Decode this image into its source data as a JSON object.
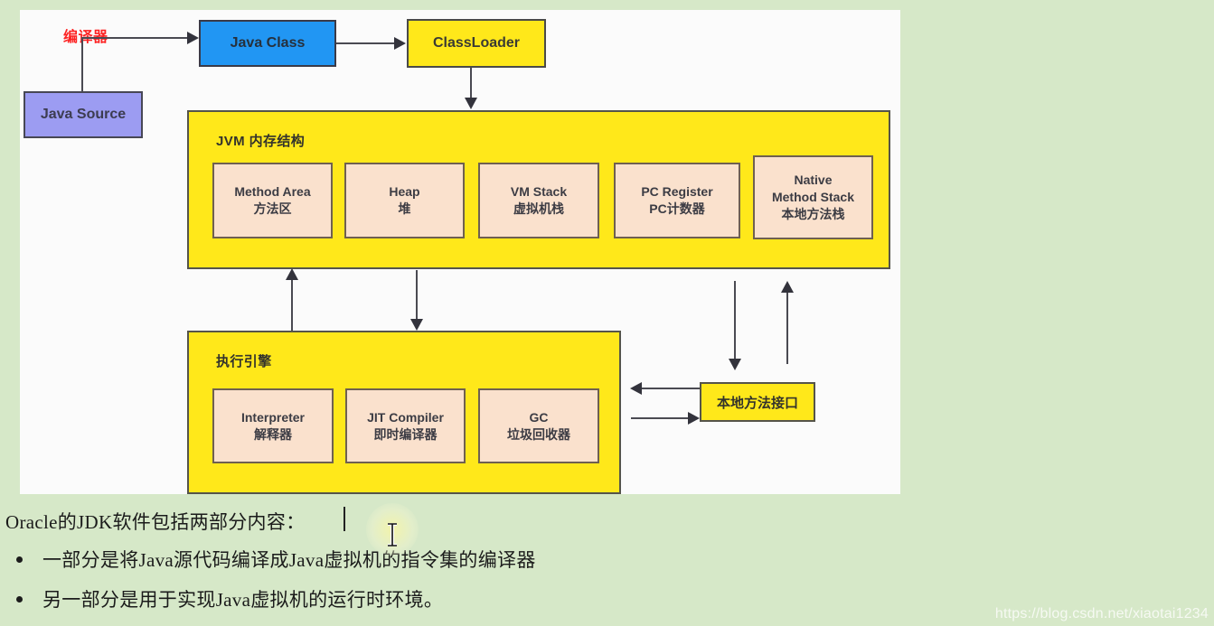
{
  "diagram": {
    "compiler_label": "编译器",
    "java_source": "Java Source",
    "java_class": "Java Class",
    "class_loader": "ClassLoader",
    "jvm_memory_title": "JVM 内存结构",
    "exec_engine_title": "执行引擎",
    "native_interface": "本地方法接口",
    "memory_areas": [
      {
        "en": "Method Area",
        "cn": "方法区"
      },
      {
        "en": "Heap",
        "cn": "堆"
      },
      {
        "en": "VM Stack",
        "cn": "虚拟机栈"
      },
      {
        "en": "PC Register",
        "cn": "PC计数器"
      },
      {
        "en": "Native",
        "en2": "Method Stack",
        "cn": "本地方法栈"
      }
    ],
    "exec_components": [
      {
        "en": "Interpreter",
        "cn": "解释器"
      },
      {
        "en": "JIT Compiler",
        "cn": "即时编译器"
      },
      {
        "en": "GC",
        "cn": "垃圾回收器"
      }
    ],
    "colors": {
      "page_background": "#d6e8c8",
      "panel_background": "#fbfbfb",
      "java_source_fill": "#9c9cf2",
      "java_class_fill": "#2196f3",
      "yellow_fill": "#ffe81a",
      "inner_box_fill": "#fae1cd",
      "compiler_label_color": "#fd2222",
      "line_color": "#4a4a52"
    }
  },
  "text": {
    "intro": "Oracle的JDK软件包括两部分内容：",
    "bullets": [
      "一部分是将Java源代码编译成Java虚拟机的指令集的编译器",
      "另一部分是用于实现Java虚拟机的运行时环境。"
    ]
  },
  "watermark": "https://blog.csdn.net/xiaotai1234"
}
